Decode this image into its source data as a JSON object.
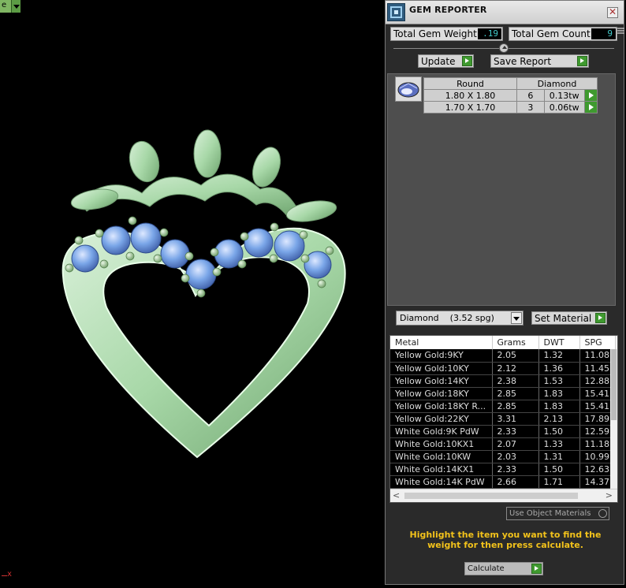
{
  "viewport": {
    "tab_label": "e",
    "axis_label": "x",
    "colors": {
      "metal": "#a8d8a8",
      "gem": "#7aa6e8",
      "prong": "#a6c9a0"
    }
  },
  "panel": {
    "title": "GEM REPORTER",
    "close_glyph": "✕",
    "total_gem_weight_label": "Total Gem Weight",
    "total_gem_weight_value": ".19",
    "total_gem_count_label": "Total Gem Count",
    "total_gem_count_value": "9",
    "update_label": "Update",
    "save_report_label": "Save Report",
    "gem_header": {
      "shape": "Round",
      "material": "Diamond"
    },
    "gem_rows": [
      {
        "size": "1.80 X 1.80",
        "count": "6",
        "weight": "0.13tw"
      },
      {
        "size": "1.70 X 1.70",
        "count": "3",
        "weight": "0.06tw"
      }
    ],
    "material_select": "Diamond    (3.52 spg)",
    "set_material_label": "Set Material",
    "metal_table": {
      "headers": [
        "Metal",
        "Grams",
        "DWT",
        "SPG"
      ],
      "rows": [
        [
          "Yellow Gold:9KY",
          "2.05",
          "1.32",
          "11.08"
        ],
        [
          "Yellow Gold:10KY",
          "2.12",
          "1.36",
          "11.45"
        ],
        [
          "Yellow Gold:14KY",
          "2.38",
          "1.53",
          "12.88"
        ],
        [
          "Yellow Gold:18KY",
          "2.85",
          "1.83",
          "15.41"
        ],
        [
          "Yellow Gold:18KY R...",
          "2.85",
          "1.83",
          "15.41"
        ],
        [
          "Yellow Gold:22KY",
          "3.31",
          "2.13",
          "17.89"
        ],
        [
          "White Gold:9K PdW",
          "2.33",
          "1.50",
          "12.59"
        ],
        [
          "White Gold:10KX1",
          "2.07",
          "1.33",
          "11.18"
        ],
        [
          "White Gold:10KW",
          "2.03",
          "1.31",
          "10.99"
        ],
        [
          "White Gold:14KX1",
          "2.33",
          "1.50",
          "12.63"
        ],
        [
          "White Gold:14K PdW",
          "2.66",
          "1.71",
          "14.37"
        ]
      ]
    },
    "use_object_materials_label": "Use Object Materials",
    "hint": "Highlight the item you want to find the weight for then press calculate.",
    "calculate_label": "Calculate"
  }
}
